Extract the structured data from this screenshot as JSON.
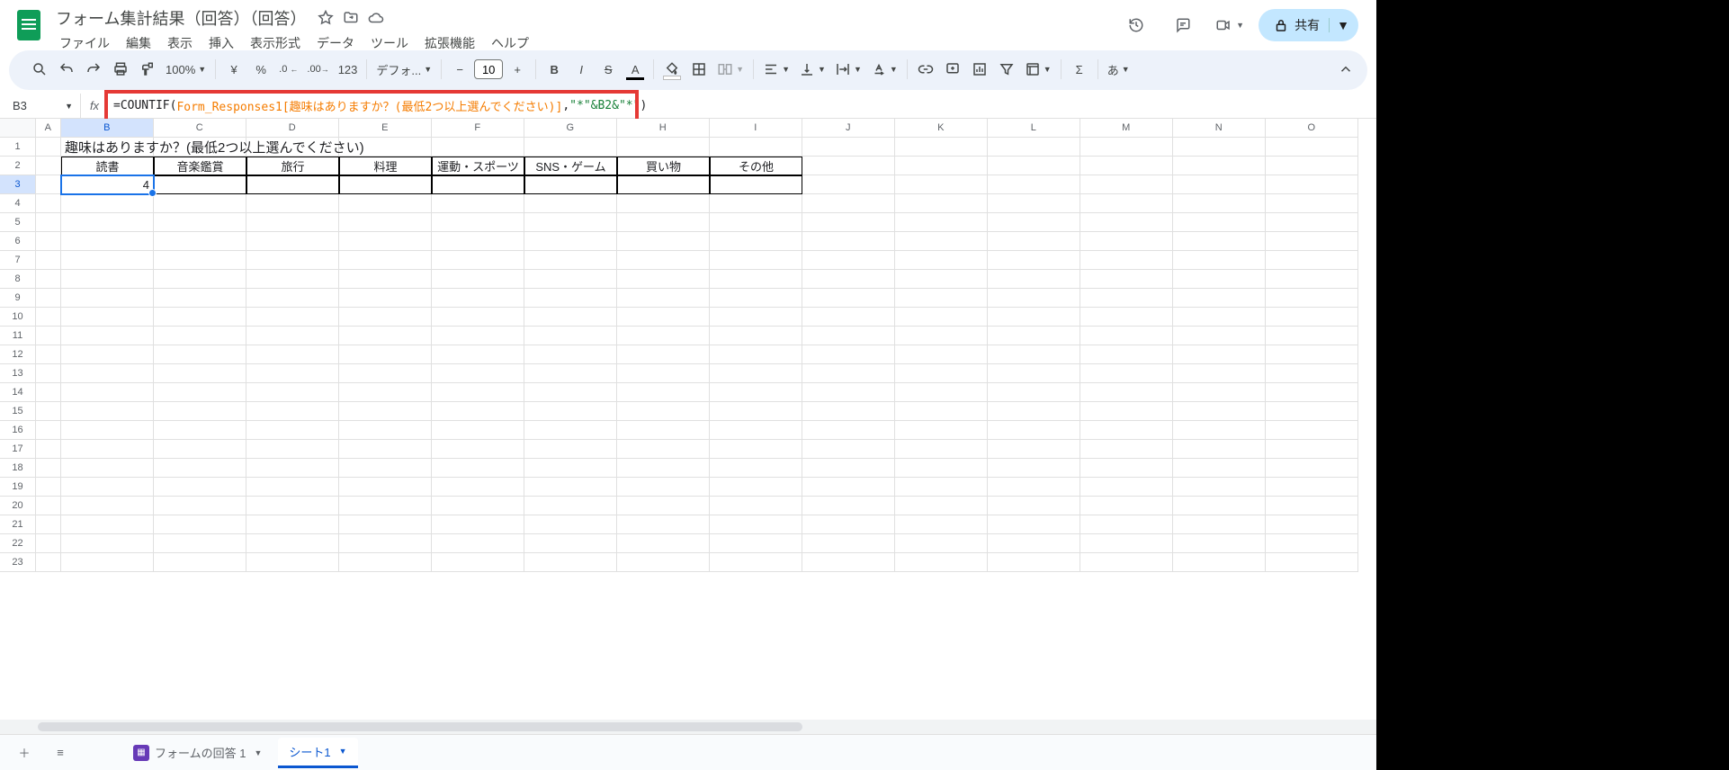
{
  "doc": {
    "title": "フォーム集計結果（回答）（回答）"
  },
  "menus": [
    "ファイル",
    "編集",
    "表示",
    "挿入",
    "表示形式",
    "データ",
    "ツール",
    "拡張機能",
    "ヘルプ"
  ],
  "share": {
    "label": "共有"
  },
  "toolbar": {
    "zoom": "100%",
    "currency": "¥",
    "percent": "%",
    "dec_dec": ".0",
    "inc_dec": ".00",
    "num_fmt": "123",
    "font_name": "デフォ...",
    "font_size": "10",
    "input_mode": "あ"
  },
  "name_box": "B3",
  "formula": {
    "prefix": "=COUNTIF(",
    "range": "Form_Responses1[趣味はありますか？(最低2つ以上選んでください)]",
    "mid": ",",
    "str": "\"*\"&B2&\"*\"",
    "suffix": ")"
  },
  "columns": [
    "A",
    "B",
    "C",
    "D",
    "E",
    "F",
    "G",
    "H",
    "I",
    "J",
    "K",
    "L",
    "M",
    "N",
    "O"
  ],
  "rows": [
    "1",
    "2",
    "3",
    "4",
    "5",
    "6",
    "7",
    "8",
    "9",
    "10",
    "11",
    "12",
    "13",
    "14",
    "15",
    "16",
    "17",
    "18",
    "19",
    "20",
    "21",
    "22",
    "23"
  ],
  "table": {
    "question": "趣味はありますか？(最低2つ以上選んでください)",
    "headers": [
      "読書",
      "音楽鑑賞",
      "旅行",
      "料理",
      "運動・スポーツ",
      "SNS・ゲーム",
      "買い物",
      "その他"
    ],
    "values": [
      "4",
      "",
      "",
      "",
      "",
      "",
      "",
      ""
    ]
  },
  "sheets": {
    "tab1": "フォームの回答 1",
    "tab2": "シート1"
  }
}
